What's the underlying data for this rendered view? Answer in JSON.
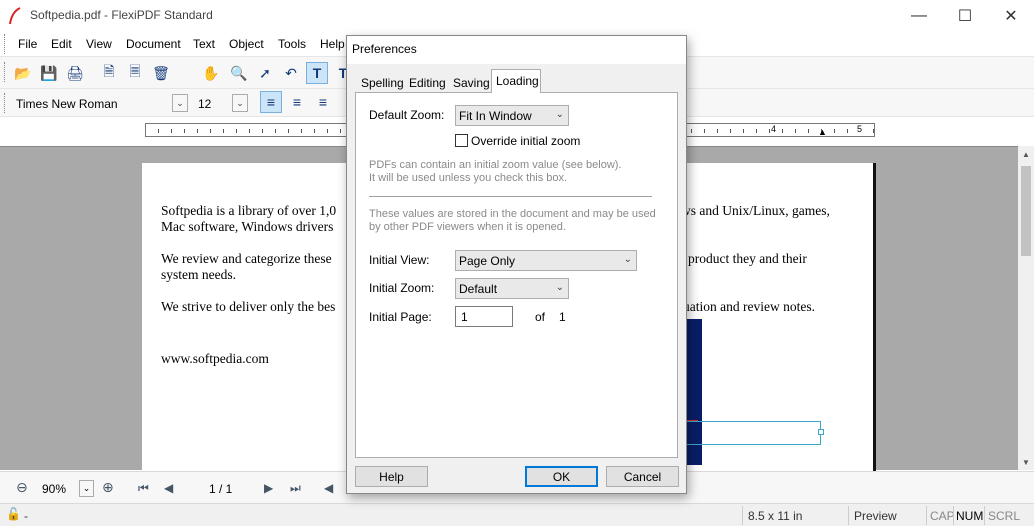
{
  "window": {
    "title": "Softpedia.pdf - FlexiPDF Standard",
    "controls": {
      "minimize": "—",
      "maximize": "☐",
      "close": "✕"
    }
  },
  "menu": [
    "File",
    "Edit",
    "View",
    "Document",
    "Text",
    "Object",
    "Tools",
    "Help"
  ],
  "toolbar": {
    "icons": [
      "open-folder-icon",
      "save-icon",
      "print-icon",
      "new-page-icon",
      "page-icon",
      "pages-icon",
      "hand-tool-icon",
      "zoom-tool-icon",
      "select-arrow-icon",
      "undo-icon",
      "text-tool-icon",
      "text-frame-icon"
    ],
    "font_family": "Times New Roman",
    "font_size": "12",
    "align_icons": [
      "align-left-icon",
      "align-center-icon",
      "align-right-icon"
    ]
  },
  "ruler": {
    "labels": [
      "4",
      "5"
    ]
  },
  "document": {
    "lines": [
      "Softpedia is a library of over 1,0",
      "Mac software, Windows drivers",
      "We review and categorize these",
      "system needs.",
      "We strive to deliver only the bes",
      "www.softpedia.com"
    ],
    "right_fragments": [
      "ws and Unix/Linux, games,",
      "product they and their",
      "uation and review notes."
    ]
  },
  "navbar": {
    "zoom": "90%",
    "page": "1 / 1"
  },
  "statusbar": {
    "lock": "-",
    "page_size": "8.5 x 11 in",
    "mode": "Preview",
    "cap": "CAP",
    "num": "NUM",
    "scrl": "SCRL"
  },
  "dialog": {
    "title": "Preferences",
    "tabs": [
      "Spelling",
      "Editing",
      "Saving",
      "Loading"
    ],
    "active_tab": "Loading",
    "default_zoom_label": "Default Zoom:",
    "default_zoom_value": "Fit In Window",
    "override_label": "Override initial zoom",
    "override_checked": false,
    "hint1_line1": "PDFs can contain an initial zoom value (see below).",
    "hint1_line2": "It will be used unless you check this box.",
    "hint2_line1": "These values are stored in the document and may be used",
    "hint2_line2": "by other PDF viewers when it is opened.",
    "initial_view_label": "Initial View:",
    "initial_view_value": "Page Only",
    "initial_zoom_label": "Initial Zoom:",
    "initial_zoom_value": "Default",
    "initial_page_label": "Initial Page:",
    "initial_page_value": "1",
    "of_label": "of",
    "total_pages": "1",
    "help_button": "Help",
    "ok_button": "OK",
    "cancel_button": "Cancel"
  }
}
